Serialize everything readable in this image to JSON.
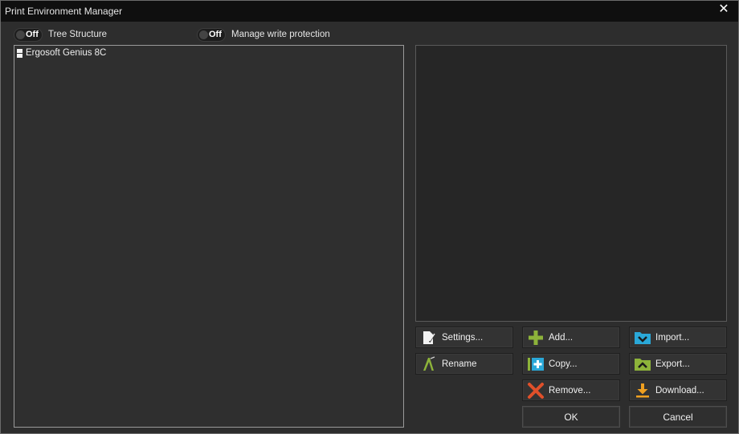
{
  "window": {
    "title": "Print Environment Manager",
    "close_glyph": "✕"
  },
  "toggles": [
    {
      "state": "Off",
      "label": "Tree Structure"
    },
    {
      "state": "Off",
      "label": "Manage write protection"
    }
  ],
  "tree": {
    "items": [
      {
        "label": "Ergosoft Genius 8C",
        "icon": "environment-icon"
      }
    ]
  },
  "buttons": {
    "settings": {
      "label": "Settings...",
      "icon": "settings-icon"
    },
    "rename": {
      "label": "Rename",
      "icon": "rename-icon"
    },
    "add": {
      "label": "Add...",
      "icon": "add-icon",
      "color": "#8db33a"
    },
    "copy": {
      "label": "Copy...",
      "icon": "copy-icon",
      "color": "#2aa8d8"
    },
    "remove": {
      "label": "Remove...",
      "icon": "remove-icon",
      "color": "#e0502a"
    },
    "import": {
      "label": "Import...",
      "icon": "import-icon",
      "color": "#2aa8d8"
    },
    "export": {
      "label": "Export...",
      "icon": "export-icon",
      "color": "#8db33a"
    },
    "download": {
      "label": "Download...",
      "icon": "download-icon",
      "color": "#f0a020"
    },
    "ok": {
      "label": "OK"
    },
    "cancel": {
      "label": "Cancel"
    }
  }
}
